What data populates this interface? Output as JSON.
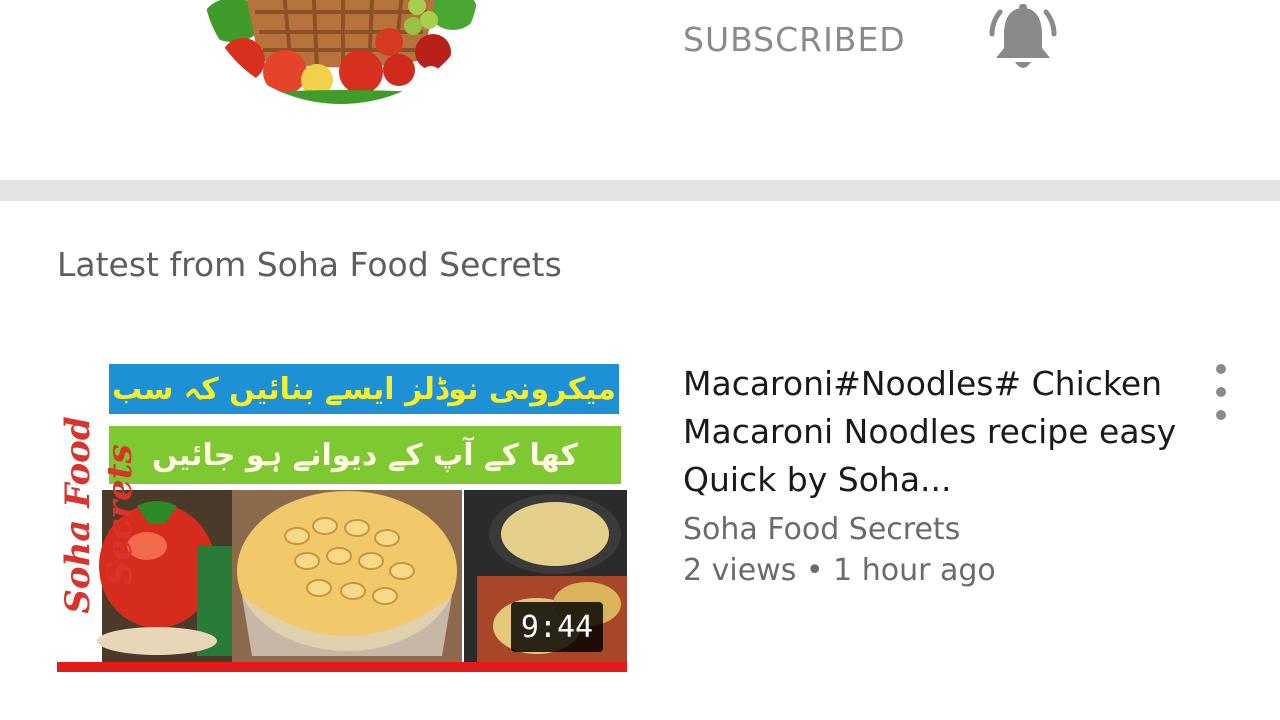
{
  "channel_header": {
    "avatar_icon": "vegetable-basket-avatar",
    "subscribe_label": "SUBSCRIBED",
    "bell_icon": "notification-bell-icon"
  },
  "section": {
    "title": "Latest from Soha Food Secrets"
  },
  "video": {
    "thumbnail": {
      "urdu_line1": "میکرونی نوڈلز ایسے بنائیں کہ سب",
      "urdu_line2": "کھا کے آپ کے دیوانے ہو جائیں",
      "brand_text": "Soha Food Secrets",
      "duration": "9:44"
    },
    "title": "Macaroni#Noodles# Chicken Macaroni Noodles recipe easy Quick by Soha...",
    "channel": "Soha Food Secrets",
    "meta": "2 views • 1 hour ago",
    "menu_icon": "more-vert-icon"
  },
  "colors": {
    "accent_red": "#e41b1b",
    "urdu_blue": "#1e90d6",
    "urdu_green": "#7ec832",
    "divider": "#e3e3e3"
  }
}
